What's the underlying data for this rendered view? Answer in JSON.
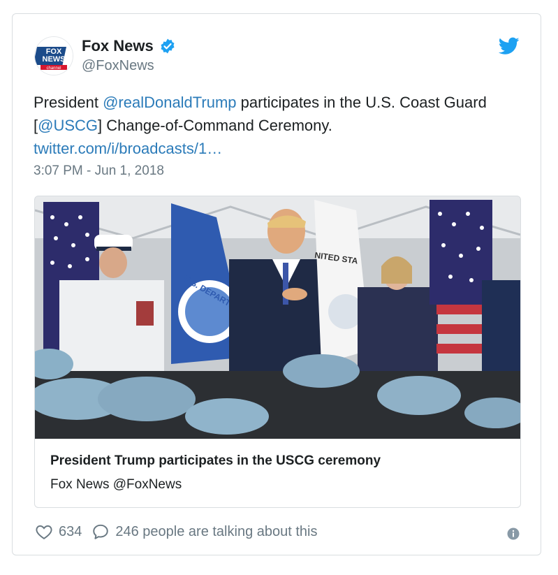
{
  "tweet": {
    "author": {
      "display_name": "Fox News",
      "handle": "@FoxNews",
      "avatar_lines": [
        "FOX",
        "NEWS",
        "channel"
      ],
      "verified": true
    },
    "text": {
      "part1": "President ",
      "mention1": "@realDonaldTrump",
      "part2": " participates in the U.S. Coast Guard [",
      "mention2": "@USCG",
      "part3": "] Change-of-Command Ceremony.",
      "link": "twitter.com/i/broadcasts/1…"
    },
    "timestamp": "3:07 PM - Jun 1, 2018",
    "media_card": {
      "title": "President Trump participates in the USCG ceremony",
      "source": "Fox News @FoxNews",
      "image_banner_texts": [
        "U.S. DEPARTMENT",
        "NITED STA"
      ]
    },
    "actions": {
      "likes": "634",
      "talking": "246 people are talking about this"
    },
    "colors": {
      "link": "#2b7bb9",
      "secondary_text": "#697882",
      "verified": "#1da1f2",
      "twitter_bird": "#1da1f2"
    }
  }
}
